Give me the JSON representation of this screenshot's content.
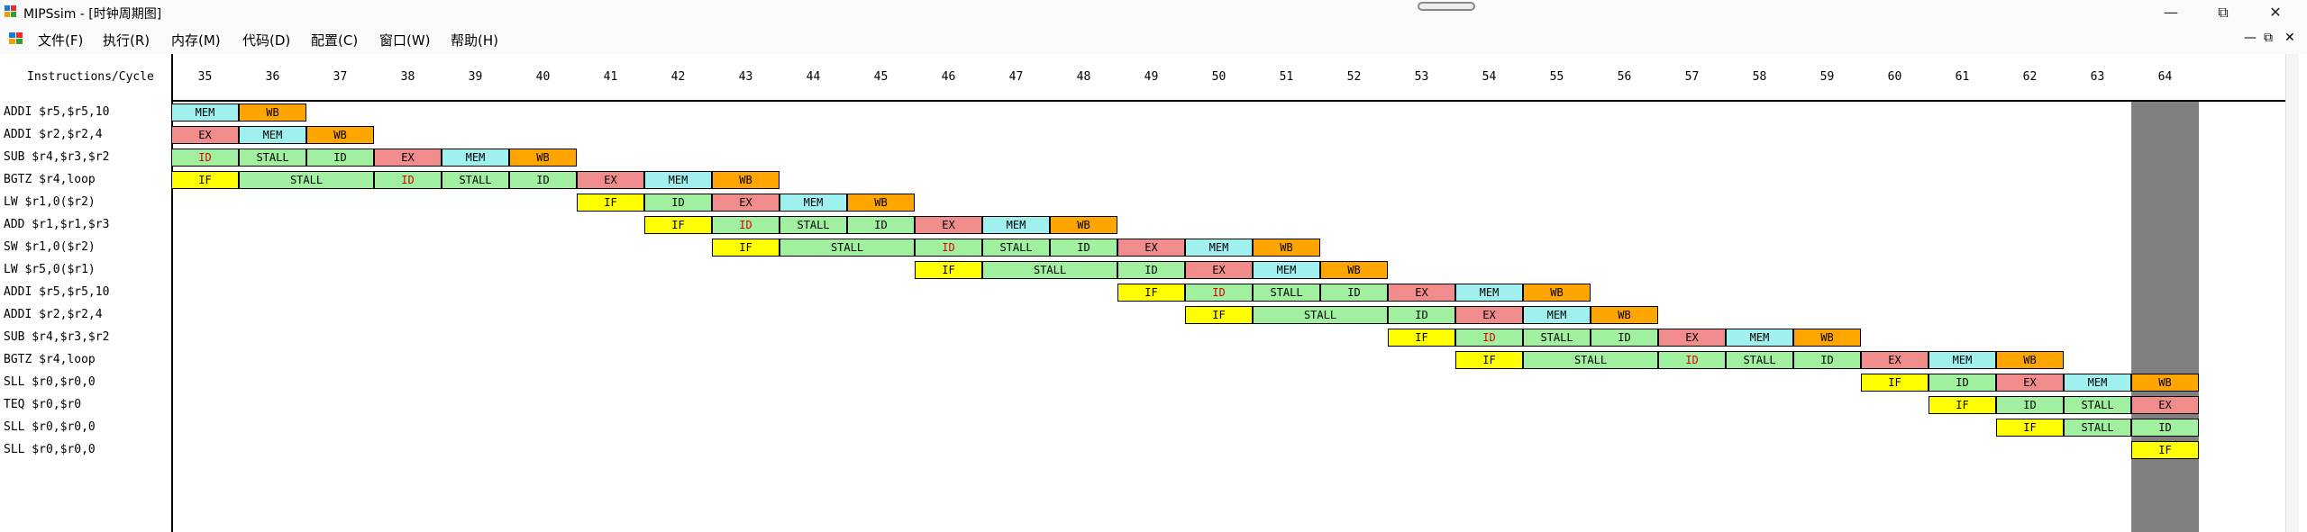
{
  "window": {
    "title": "MIPSsim - [时钟周期图]",
    "minimize": "—",
    "maximize": "⧉",
    "close": "✕"
  },
  "menu": [
    {
      "label": "文件(F)"
    },
    {
      "label": "执行(R)"
    },
    {
      "label": "内存(M)"
    },
    {
      "label": "代码(D)"
    },
    {
      "label": "配置(C)"
    },
    {
      "label": "窗口(W)"
    },
    {
      "label": "帮助(H)"
    }
  ],
  "mdi": {
    "minimize": "—",
    "restore": "⧉",
    "close": "✕"
  },
  "diagram": {
    "header_label": "Instructions/Cycle",
    "highlight_cycle": 64,
    "cycles": [
      35,
      36,
      37,
      38,
      39,
      40,
      41,
      42,
      43,
      44,
      45,
      46,
      47,
      48,
      49,
      50,
      51,
      52,
      53,
      54,
      55,
      56,
      57,
      58,
      59,
      60,
      61,
      62,
      63,
      64
    ],
    "instructions": [
      {
        "text": "ADDI $r5,$r5,10",
        "stages": [
          [
            "MEM",
            35,
            35
          ],
          [
            "WB",
            36,
            36
          ]
        ]
      },
      {
        "text": "ADDI $r2,$r2,4",
        "stages": [
          [
            "EX",
            35,
            35
          ],
          [
            "MEM",
            36,
            36
          ],
          [
            "WB",
            37,
            37
          ]
        ]
      },
      {
        "text": "SUB $r4,$r3,$r2",
        "stages": [
          [
            "ID",
            35,
            35
          ],
          [
            "STALL",
            36,
            36
          ],
          [
            "ID",
            37,
            37
          ],
          [
            "EX",
            38,
            38
          ],
          [
            "MEM",
            39,
            39
          ],
          [
            "WB",
            40,
            40
          ]
        ]
      },
      {
        "text": "BGTZ $r4,loop",
        "stages": [
          [
            "IF",
            35,
            35
          ],
          [
            "STALL",
            36,
            37
          ],
          [
            "ID",
            38,
            38
          ],
          [
            "STALL",
            39,
            39
          ],
          [
            "ID",
            40,
            40
          ],
          [
            "EX",
            41,
            41
          ],
          [
            "MEM",
            42,
            42
          ],
          [
            "WB",
            43,
            43
          ]
        ]
      },
      {
        "text": "LW $r1,0($r2)",
        "stages": [
          [
            "IF",
            41,
            41
          ],
          [
            "ID",
            42,
            42
          ],
          [
            "EX",
            43,
            43
          ],
          [
            "MEM",
            44,
            44
          ],
          [
            "WB",
            45,
            45
          ]
        ]
      },
      {
        "text": "ADD $r1,$r1,$r3",
        "stages": [
          [
            "IF",
            42,
            42
          ],
          [
            "ID",
            43,
            43
          ],
          [
            "STALL",
            44,
            44
          ],
          [
            "ID",
            45,
            45
          ],
          [
            "EX",
            46,
            46
          ],
          [
            "MEM",
            47,
            47
          ],
          [
            "WB",
            48,
            48
          ]
        ]
      },
      {
        "text": "SW $r1,0($r2)",
        "stages": [
          [
            "IF",
            43,
            43
          ],
          [
            "STALL",
            44,
            45
          ],
          [
            "ID",
            46,
            46
          ],
          [
            "STALL",
            47,
            47
          ],
          [
            "ID",
            48,
            48
          ],
          [
            "EX",
            49,
            49
          ],
          [
            "MEM",
            50,
            50
          ],
          [
            "WB",
            51,
            51
          ]
        ]
      },
      {
        "text": "LW $r5,0($r1)",
        "stages": [
          [
            "IF",
            46,
            46
          ],
          [
            "STALL",
            47,
            48
          ],
          [
            "ID",
            49,
            49
          ],
          [
            "EX",
            50,
            50
          ],
          [
            "MEM",
            51,
            51
          ],
          [
            "WB",
            52,
            52
          ]
        ]
      },
      {
        "text": "ADDI $r5,$r5,10",
        "stages": [
          [
            "IF",
            49,
            49
          ],
          [
            "ID",
            50,
            50
          ],
          [
            "STALL",
            51,
            51
          ],
          [
            "ID",
            52,
            52
          ],
          [
            "EX",
            53,
            53
          ],
          [
            "MEM",
            54,
            54
          ],
          [
            "WB",
            55,
            55
          ]
        ]
      },
      {
        "text": "ADDI $r2,$r2,4",
        "stages": [
          [
            "IF",
            50,
            50
          ],
          [
            "STALL",
            51,
            52
          ],
          [
            "ID",
            53,
            53
          ],
          [
            "EX",
            54,
            54
          ],
          [
            "MEM",
            55,
            55
          ],
          [
            "WB",
            56,
            56
          ]
        ]
      },
      {
        "text": "SUB $r4,$r3,$r2",
        "stages": [
          [
            "IF",
            53,
            53
          ],
          [
            "ID",
            54,
            54
          ],
          [
            "STALL",
            55,
            55
          ],
          [
            "ID",
            56,
            56
          ],
          [
            "EX",
            57,
            57
          ],
          [
            "MEM",
            58,
            58
          ],
          [
            "WB",
            59,
            59
          ]
        ]
      },
      {
        "text": "BGTZ $r4,loop",
        "stages": [
          [
            "IF",
            54,
            54
          ],
          [
            "STALL",
            55,
            56
          ],
          [
            "ID",
            57,
            57
          ],
          [
            "STALL",
            58,
            58
          ],
          [
            "ID",
            59,
            59
          ],
          [
            "EX",
            60,
            60
          ],
          [
            "MEM",
            61,
            61
          ],
          [
            "WB",
            62,
            62
          ]
        ]
      },
      {
        "text": "SLL $r0,$r0,0",
        "stages": [
          [
            "IF",
            60,
            60
          ],
          [
            "ID",
            61,
            61
          ],
          [
            "EX",
            62,
            62
          ],
          [
            "MEM",
            63,
            63
          ],
          [
            "WB",
            64,
            64
          ]
        ]
      },
      {
        "text": "TEQ $r0,$r0",
        "stages": [
          [
            "IF",
            61,
            61
          ],
          [
            "ID",
            62,
            62
          ],
          [
            "STALL",
            63,
            63
          ],
          [
            "EX",
            64,
            64
          ]
        ]
      },
      {
        "text": "SLL $r0,$r0,0",
        "stages": [
          [
            "IF",
            62,
            62
          ],
          [
            "STALL",
            63,
            63
          ],
          [
            "ID",
            64,
            64
          ]
        ]
      },
      {
        "text": "SLL $r0,$r0,0",
        "stages": [
          [
            "IF",
            64,
            64
          ]
        ]
      }
    ],
    "red_id_cells": [
      [
        2,
        35
      ],
      [
        3,
        38
      ],
      [
        5,
        43
      ],
      [
        6,
        46
      ],
      [
        8,
        50
      ],
      [
        10,
        54
      ],
      [
        11,
        57
      ]
    ],
    "stage_colors": {
      "IF": "#ffff00",
      "ID": "#a0f0a0",
      "STALL": "#a0f0a0",
      "EX": "#f08c8c",
      "MEM": "#a0f0f0",
      "WB": "#ffa500",
      "highlight": "#808080",
      "red_text": "#e00000"
    }
  }
}
